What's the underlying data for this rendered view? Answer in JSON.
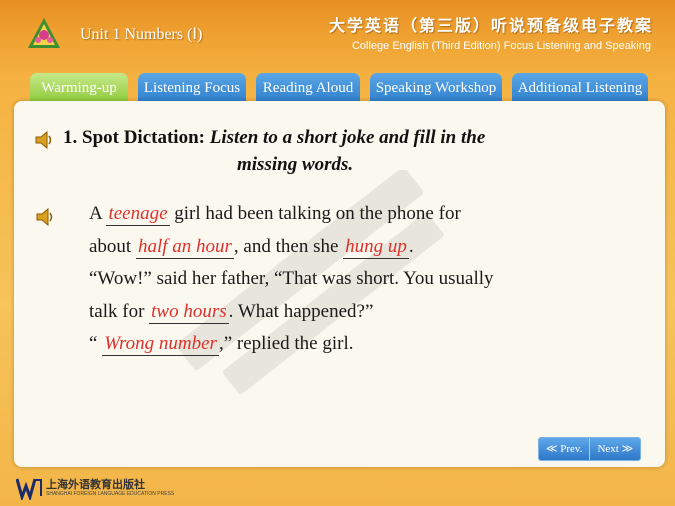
{
  "header": {
    "unit_title": "Unit 1  Numbers (Ⅰ)",
    "cn_title": "大学英语（第三版）听说预备级电子教案",
    "en_subtitle": "College English (Third Edition) Focus Listening and Speaking"
  },
  "tabs": [
    {
      "label": "Warming-up",
      "active": true
    },
    {
      "label": "Listening Focus",
      "active": false
    },
    {
      "label": "Reading Aloud",
      "active": false
    },
    {
      "label": "Speaking Workshop",
      "active": false
    },
    {
      "label": "Additional Listening",
      "active": false
    }
  ],
  "exercise": {
    "number": "1. Spot Dictation:",
    "instruction_line1": "Listen to a short joke and fill in the",
    "instruction_line2": "missing words."
  },
  "passage": {
    "line1_pre": "A ",
    "blank1": "teenage",
    "line1_post": " girl had been talking on the phone for",
    "line2_pre": "about ",
    "blank2": "half an hour",
    "line2_mid": ", and then she ",
    "blank3": "hung up",
    "line2_post": ".",
    "line3": "“Wow!” said her father, “That was short. You usually",
    "line4_pre": "talk for ",
    "blank4": "two hours",
    "line4_post": ". What happened?”",
    "line5_pre": "“ ",
    "blank5": "Wrong number",
    "line5_post": ",” replied the girl."
  },
  "nav": {
    "prev": "Prev.",
    "next": "Next"
  },
  "publisher": {
    "cn": "上海外语教育出版社",
    "en": "SHANGHAI FOREIGN LANGUAGE EDUCATION PRESS"
  },
  "colors": {
    "accent_orange": "#f0a534",
    "tab_blue": "#2f7fcd",
    "tab_active_green": "#8fcb3a",
    "answer_red": "#e0302a"
  }
}
